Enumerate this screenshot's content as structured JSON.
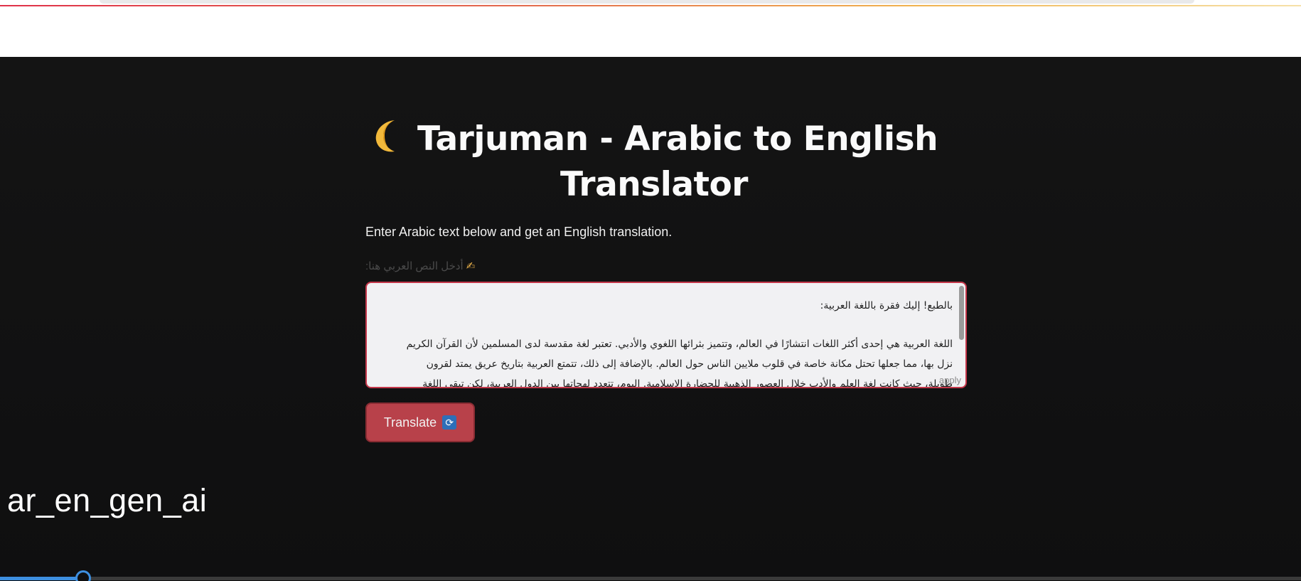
{
  "app": {
    "title": "Tarjuman - Arabic to English Translator",
    "title_icon": "crescent-moon-icon",
    "subtitle": "Enter Arabic text below and get an English translation.",
    "input_label": "أدخل النص العربي هنا:",
    "input_label_icon": "writing-hand-icon",
    "input_text_lines": [
      "بالطبع! إليك فقرة باللغة العربية:",
      "",
      "اللغة العربية هي إحدى أكثر اللغات انتشارًا في العالم، وتتميز بثرائها اللغوي والأدبي. تعتبر لغة مقدسة لدى المسلمين لأن القرآن الكريم",
      "نزل بها، مما جعلها تحتل مكانة خاصة في قلوب ملايين الناس حول العالم. بالإضافة إلى ذلك، تتمتع العربية بتاريخ عريق يمتد لقرون",
      "طويلة، حيث كانت لغة العلم والأدب خلال العصور الذهبية للحضارة الإسلامية. اليوم، تتعدد لهجاتها بين الدول العربية، لكن تبقى اللغة"
    ],
    "apply_hint": "apply",
    "translate_button": "Translate",
    "translate_icon": "refresh-icon"
  },
  "video_overlay": {
    "caption": "ar_en_gen_ai",
    "progress": 0.064
  },
  "colors": {
    "background": "#121212",
    "accent": "#c4374a",
    "button": "#b8414a",
    "progress": "#3d8fe0"
  }
}
